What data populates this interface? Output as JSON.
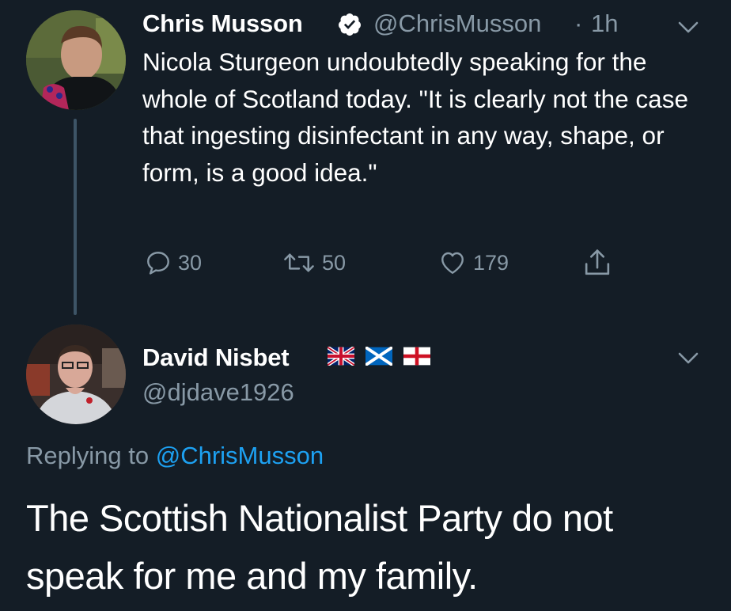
{
  "colors": {
    "background": "#141d26",
    "text": "#ffffff",
    "secondary": "#8899a6",
    "link": "#1da1f2",
    "thread_line": "#3d5466",
    "verified": "#ffffff"
  },
  "tweet1": {
    "display_name": "Chris Musson",
    "verified": true,
    "handle": "@ChrisMusson",
    "separator": "·",
    "time": "1h",
    "text": "Nicola Sturgeon undoubtedly speaking for the whole of Scotland today. \"It is clearly not the case that ingesting disinfectant in any way, shape, or form, is a good idea.\"",
    "actions": {
      "replies": "30",
      "retweets": "50",
      "likes": "179"
    },
    "icons": [
      "reply-icon",
      "retweet-icon",
      "like-icon",
      "share-icon",
      "chevron-down-icon",
      "verified-badge-icon"
    ]
  },
  "tweet2": {
    "display_name": "David Nisbet",
    "flags": [
      "union-jack-flag-icon",
      "scotland-flag-icon",
      "england-flag-icon"
    ],
    "handle": "@djdave1926",
    "replying_prefix": "Replying to ",
    "replying_to": "@ChrisMusson",
    "text": "The Scottish Nationalist Party do not speak for me and my family."
  }
}
